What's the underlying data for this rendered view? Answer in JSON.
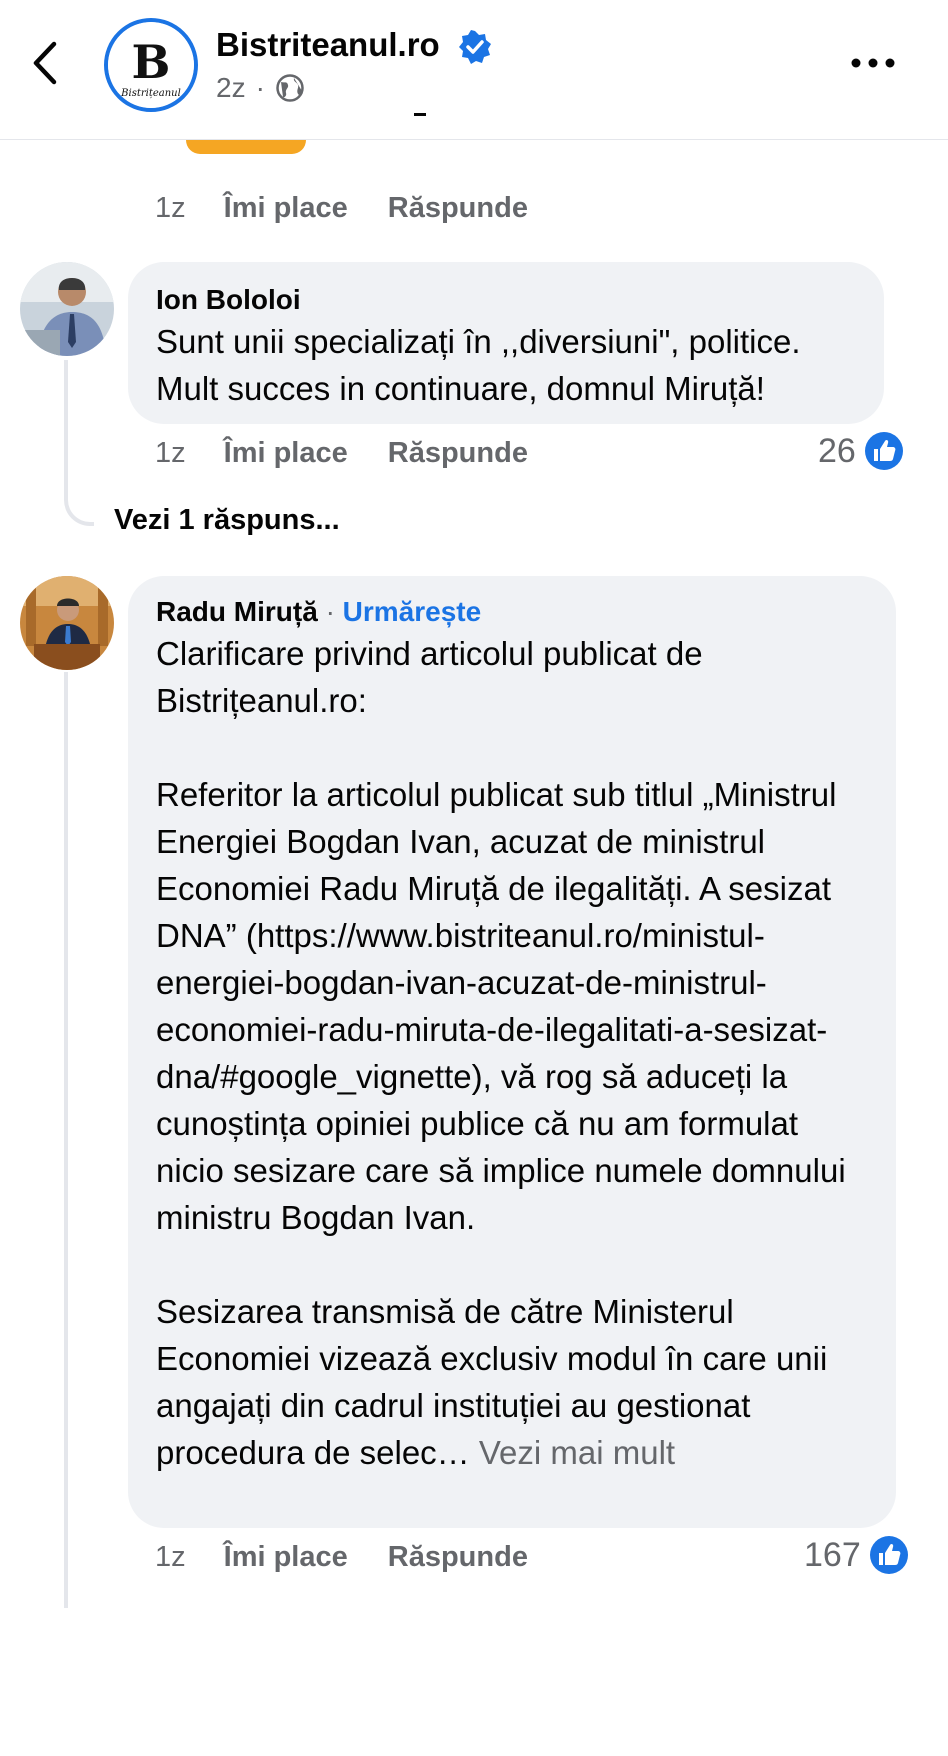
{
  "header": {
    "back_icon": "chevron-left-icon",
    "page_name": "Bistriteanul.ro",
    "logo_letter": "B",
    "logo_text": "Bistrițeanul",
    "verified_icon": "verified-badge-icon",
    "post_time": "2z",
    "separator": "·",
    "privacy_icon": "globe-icon",
    "more_icon": "more-horizontal-icon"
  },
  "previous_comment": {
    "time": "1z",
    "like_label": "Îmi place",
    "reply_label": "Răspunde"
  },
  "comments": [
    {
      "author": "Ion Bololoi",
      "text": "Sunt unii specializați în ,,diversiuni\", politice. Mult succes in continuare, domnul Miruță!",
      "time": "1z",
      "like_label": "Îmi place",
      "reply_label": "Răspunde",
      "reaction_count": "26",
      "view_replies": "Vezi 1 răspuns..."
    },
    {
      "author": "Radu Miruță",
      "separator": "·",
      "follow_label": "Urmărește",
      "text": "Clarificare privind articolul publicat de Bistrițeanul.ro:\n\nReferitor la articolul publicat sub titlul „Ministrul Energiei Bogdan Ivan, acuzat de ministrul Economiei Radu Miruță de ilegalități. A sesizat DNA” (https://www.bistriteanul.ro/ministul-energiei-bogdan-ivan-acuzat-de-ministrul-economiei-radu-miruta-de-ilegalitati-a-sesizat-dna/#google_vignette), vă rog să aduceți la cunoștința opiniei publice că nu am formulat nicio sesizare care să implice numele domnului ministru Bogdan Ivan.\n\nSesizarea transmisă de către Ministerul Economiei vizează exclusiv modul în care unii angajați din cadrul instituției au gestionat procedura de selec…",
      "see_more": "Vezi mai mult",
      "time": "1z",
      "like_label": "Îmi place",
      "reply_label": "Răspunde",
      "reaction_count": "167"
    }
  ],
  "colors": {
    "accent": "#1b74e4",
    "bubble": "#f0f2f5",
    "secondary_text": "#65676b",
    "peek": "#f5a623"
  }
}
